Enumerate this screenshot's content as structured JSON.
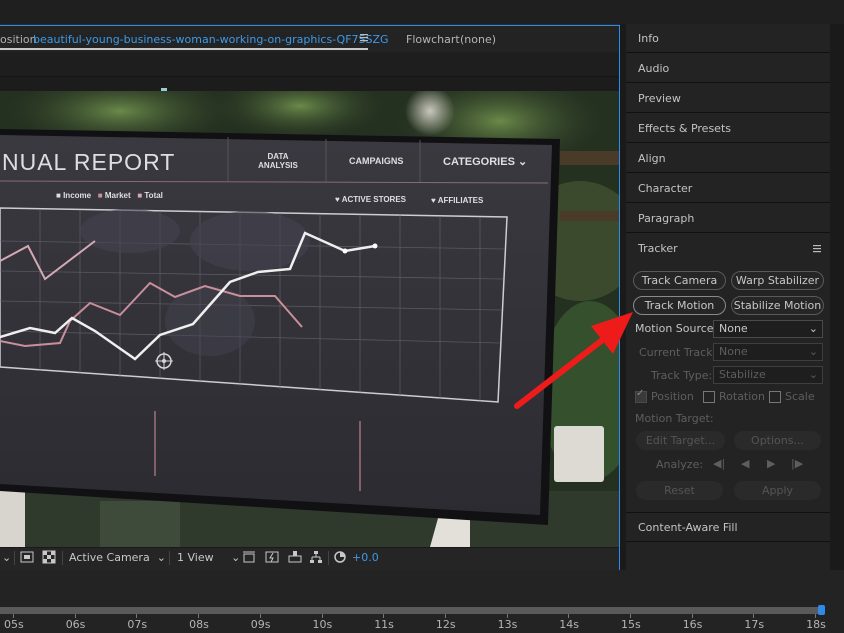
{
  "composition": {
    "tab_prefix": "osition",
    "tab_name": "beautiful-young-business-woman-working-on-graphics-QF7SSZG",
    "menu_icon": "hamburger-menu-icon",
    "flowchart_label": "Flowchart",
    "flowchart_value": "(none)"
  },
  "screen": {
    "title": "NUAL REPORT",
    "nav": [
      "DATA",
      "ANALYSIS",
      "CAMPAIGNS",
      "CATEGORIES"
    ],
    "legend": [
      "Income",
      "Market",
      "Total"
    ],
    "active_stores": "ACTIVE STORES",
    "affiliates": "AFFILIATES"
  },
  "viewer_bar": {
    "camera": "Active Camera",
    "view": "1 View",
    "exposure": "+0.0"
  },
  "panels": [
    "Info",
    "Audio",
    "Preview",
    "Effects & Presets",
    "Align",
    "Character",
    "Paragraph"
  ],
  "tracker": {
    "title": "Tracker",
    "buttons": [
      "Track Camera",
      "Warp Stabilizer",
      "Track Motion",
      "Stabilize Motion"
    ],
    "motion_source_label": "Motion Source:",
    "motion_source_value": "None",
    "current_track_label": "Current Track:",
    "current_track_value": "None",
    "track_type_label": "Track Type:",
    "track_type_value": "Stabilize",
    "position": "Position",
    "rotation": "Rotation",
    "scale": "Scale",
    "motion_target_label": "Motion Target:",
    "edit_target": "Edit Target...",
    "options": "Options...",
    "analyze_label": "Analyze:",
    "reset": "Reset",
    "apply": "Apply"
  },
  "content_aware_fill": "Content-Aware Fill",
  "timeline": {
    "ticks": [
      "05s",
      "06s",
      "07s",
      "08s",
      "09s",
      "10s",
      "11s",
      "12s",
      "13s",
      "14s",
      "15s",
      "16s",
      "17s",
      "18s"
    ]
  },
  "colors": {
    "accent": "#2d8ceb",
    "arrow": "#ee1b1b",
    "link": "#3d9ae8"
  }
}
